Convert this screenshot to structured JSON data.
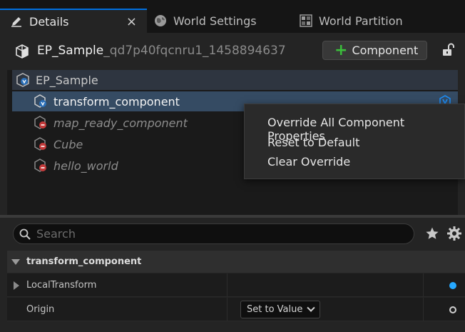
{
  "tabs": [
    {
      "label": "Details",
      "active": true,
      "icon": "pencil-icon",
      "close": "×"
    },
    {
      "label": "World Settings",
      "active": false,
      "icon": "globe-icon"
    },
    {
      "label": "World Partition",
      "active": false,
      "icon": "grid-icon"
    }
  ],
  "header": {
    "actor_name": "EP_Sample",
    "actor_id": "_qd7p40fqcnru1_1458894637",
    "add_component_label": "Component"
  },
  "tree": {
    "root": "EP_Sample",
    "components": [
      {
        "label": "transform_component",
        "selected": true
      },
      {
        "label": "map_ready_component",
        "selected": false
      },
      {
        "label": "Cube",
        "selected": false
      },
      {
        "label": "hello_world",
        "selected": false
      }
    ]
  },
  "context_menu": {
    "items": [
      "Override All Component Properties",
      "Reset to Default",
      "Clear Override"
    ]
  },
  "search": {
    "placeholder": "Search"
  },
  "details": {
    "section_title": "transform_component",
    "properties": [
      {
        "label": "LocalTransform",
        "expandable": true,
        "override_state": "overridden"
      },
      {
        "label": "Origin",
        "expandable": false,
        "value": "Set to Value",
        "override_state": "default"
      }
    ]
  },
  "colors": {
    "accent": "#0070e0",
    "selection": "#354b63",
    "override_dot": "#26a8ff",
    "add_plus": "#3bbf3b"
  }
}
